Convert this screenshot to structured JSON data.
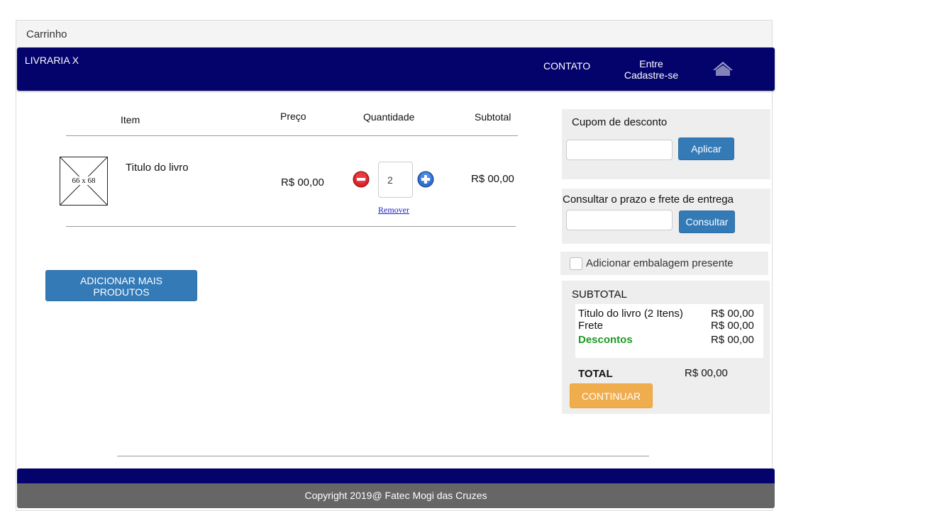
{
  "window": {
    "title": "Carrinho"
  },
  "navbar": {
    "brand": "LIVRARIA X",
    "contato": "CONTATO",
    "entre_line1": "Entre",
    "entre_line2": "Cadastre-se",
    "home_icon": "home-icon",
    "bg_color": "#03036b"
  },
  "cart_table": {
    "headers": {
      "item": "Item",
      "preco": "Preço",
      "quantidade": "Quantidade",
      "subtotal": "Subtotal"
    },
    "rows": [
      {
        "thumbnail_placeholder": "66 x 68",
        "title": "Titulo do livro",
        "price": "R$ 00,00",
        "quantity": "2",
        "remove_label": "Remover",
        "subtotal": "R$ 00,00"
      }
    ]
  },
  "add_more_button": {
    "line1": "ADICIONAR MAIS",
    "line2": "PRODUTOS"
  },
  "coupon": {
    "label": "Cupom de desconto",
    "value": "",
    "button": "Aplicar"
  },
  "shipping": {
    "label": "Consultar o prazo e frete de entrega",
    "value": "",
    "button": "Consultar"
  },
  "gift_wrap": {
    "label": "Adicionar embalagem presente",
    "checked": false
  },
  "summary": {
    "heading": "SUBTOTAL",
    "lines": [
      {
        "label": "Titulo do livro  (2 Itens)",
        "value": "R$ 00,00"
      },
      {
        "label": "Frete",
        "value": "R$ 00,00"
      },
      {
        "label": "Descontos",
        "value": "R$ 00,00"
      }
    ],
    "total_label": "TOTAL",
    "total_value": "R$ 00,00",
    "continue_button": "CONTINUAR"
  },
  "footer": {
    "text": "Copyright 2019@ Fatec Mogi das Cruzes"
  },
  "colors": {
    "primary_blue": "#337ab7",
    "orange": "#f0ad4e",
    "discount_green": "#1f9a1f",
    "minus_red": "#d9232b",
    "plus_blue": "#2f6fd1"
  }
}
